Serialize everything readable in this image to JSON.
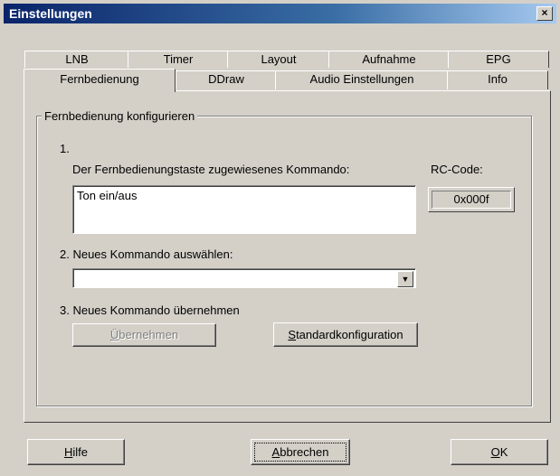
{
  "window": {
    "title": "Einstellungen",
    "close_glyph": "×"
  },
  "tabs_row_back": [
    {
      "label": "LNB"
    },
    {
      "label": "Timer"
    },
    {
      "label": "Layout"
    },
    {
      "label": "Aufnahme"
    },
    {
      "label": "EPG"
    }
  ],
  "tabs_row_front": [
    {
      "label": "Fernbedienung",
      "active": true
    },
    {
      "label": "DDraw"
    },
    {
      "label": "Audio Einstellungen"
    },
    {
      "label": "Info"
    }
  ],
  "group": {
    "legend": "Fernbedienung konfigurieren",
    "step1_number": "1.",
    "step1_label": "Der Fernbedienungstaste zugewiesenes Kommando:",
    "current_command": "Ton ein/aus",
    "rc_label": "RC-Code:",
    "rc_value": "0x000f",
    "step2_label": "2. Neues Kommando auswählen:",
    "step2_value": "",
    "step2_dropdown_glyph": "▼",
    "step3_label": "3. Neues Kommando übernehmen",
    "apply_button_mnemonic": "Ü",
    "apply_button_rest": "bernehmen",
    "default_button_mnemonic": "S",
    "default_button_rest": "tandardkonfiguration"
  },
  "footer": {
    "help_mnemonic": "H",
    "help_rest": "ilfe",
    "cancel_mnemonic": "A",
    "cancel_rest": "bbrechen",
    "ok_mnemonic": "O",
    "ok_rest": "K"
  },
  "colors": {
    "face": "#d4d0c8",
    "title_start": "#0a246a",
    "title_end": "#a6caf0"
  }
}
